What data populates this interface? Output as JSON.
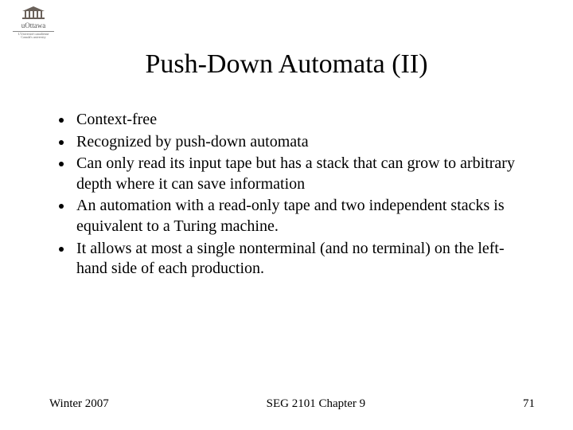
{
  "logo": {
    "name": "uOttawa",
    "subtitle": "L'Université canadienne Canada's university"
  },
  "title": "Push-Down Automata (II)",
  "bullets": [
    "Context-free",
    "Recognized by push-down automata",
    "Can only read its input tape but has a stack that can grow to arbitrary depth where it can save information",
    "An automation with a read-only tape and two independent stacks is equivalent to a Turing machine.",
    "It allows at most a single nonterminal (and no terminal) on the left-hand side of each production."
  ],
  "footer": {
    "left": "Winter 2007",
    "center": "SEG 2101 Chapter 9",
    "right": "71"
  }
}
